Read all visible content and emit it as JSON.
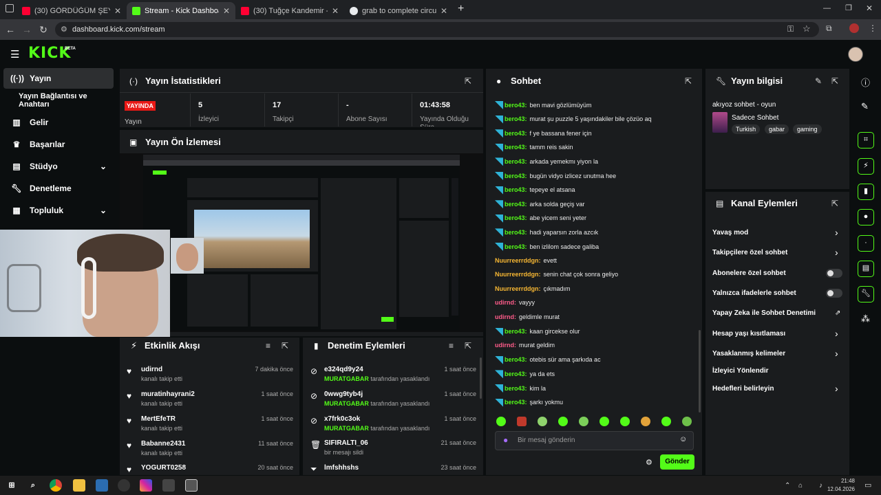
{
  "browser": {
    "tabs": [
      {
        "title": "(30) GÖRDÜĞÜM ŞEYLER GERÇ",
        "active": false
      },
      {
        "title": "Stream - Kick Dashboard",
        "active": true
      },
      {
        "title": "(30) Tuğçe Kandemir - Yanlış -",
        "active": false
      },
      {
        "title": "grab to complete circuit çeviri",
        "active": false
      }
    ],
    "new_tab": "+",
    "url": "dashboard.kick.com/stream"
  },
  "app": {
    "logo": "KICK",
    "beta": "BETA"
  },
  "sidebar": {
    "items": [
      {
        "label": "Yayın",
        "icon": "broadcast-icon"
      },
      {
        "label": "Yayın Bağlantısı ve Anahtarı",
        "icon": ""
      },
      {
        "label": "Gelir",
        "icon": "chart-icon"
      },
      {
        "label": "Başarılar",
        "icon": "trophy-icon"
      },
      {
        "label": "Stüdyo",
        "icon": "studio-icon"
      },
      {
        "label": "Denetleme",
        "icon": "wrench-icon"
      },
      {
        "label": "Topluluk",
        "icon": "community-icon"
      }
    ]
  },
  "stats": {
    "title": "Yayın İstatistikleri",
    "live_badge": "YAYINDA",
    "live_label": "Yayın",
    "items": [
      {
        "value": "5",
        "label": "İzleyici"
      },
      {
        "value": "17",
        "label": "Takipçi"
      },
      {
        "value": "-",
        "label": "Abone Sayısı"
      },
      {
        "value": "01:43:58",
        "label": "Yayında Olduğu Süre"
      }
    ]
  },
  "preview": {
    "title": "Yayın Ön İzlemesi"
  },
  "activity": {
    "title": "Etkinlik Akışı",
    "rows": [
      {
        "name": "udirnd",
        "sub": "kanalı takip etti",
        "time": "7 dakika önce"
      },
      {
        "name": "muratinhayrani2",
        "sub": "kanalı takip etti",
        "time": "1 saat önce"
      },
      {
        "name": "MertEfeTR",
        "sub": "kanalı takip etti",
        "time": "1 saat önce"
      },
      {
        "name": "Babanne2431",
        "sub": "kanalı takip etti",
        "time": "11 saat önce"
      },
      {
        "name": "YOGURT0258",
        "sub": "",
        "time": "20 saat önce"
      }
    ]
  },
  "moderation": {
    "title": "Denetim Eylemleri",
    "rows": [
      {
        "name": "e324qd9y24",
        "mod": "MURATGABAR",
        "sub": "tarafından yasaklandı",
        "time": "1 saat önce",
        "icon": "ban-icon"
      },
      {
        "name": "0wwg9tyb4j",
        "mod": "MURATGABAR",
        "sub": "tarafından yasaklandı",
        "time": "1 saat önce",
        "icon": "ban-icon"
      },
      {
        "name": "x7frk0c3ok",
        "mod": "MURATGABAR",
        "sub": "tarafından yasaklandı",
        "time": "1 saat önce",
        "icon": "ban-icon"
      },
      {
        "name": "SIFIRALTI_06",
        "mod": "",
        "sub": "bir mesajı sildi",
        "time": "21 saat önce",
        "icon": "trash-icon"
      },
      {
        "name": "lmfshhshs",
        "mod": "",
        "sub": "",
        "time": "23 saat önce",
        "icon": "filter-icon"
      }
    ]
  },
  "chat": {
    "title": "Sohbet",
    "messages": [
      {
        "user": "bero43",
        "text": "ben mavi gözlümüyüm",
        "color": "#53fc18",
        "badge": true
      },
      {
        "user": "bero43",
        "text": "murat şu puzzle 5 yaşındakiler bile çözüo aq",
        "color": "#53fc18",
        "badge": true
      },
      {
        "user": "bero43",
        "text": "f ye bassana fener için",
        "color": "#53fc18",
        "badge": true
      },
      {
        "user": "bero43",
        "text": "tamm reis sakin",
        "color": "#53fc18",
        "badge": true
      },
      {
        "user": "bero43",
        "text": "arkada yemekmı yiyon la",
        "color": "#53fc18",
        "badge": true
      },
      {
        "user": "bero43",
        "text": "bugün vidyo izlicez unutma hee",
        "color": "#53fc18",
        "badge": true
      },
      {
        "user": "bero43",
        "text": "tepeye el atsana",
        "color": "#53fc18",
        "badge": true
      },
      {
        "user": "bero43",
        "text": "arka solda geçiş var",
        "color": "#53fc18",
        "badge": true
      },
      {
        "user": "bero43",
        "text": "abe yicem seni yeter",
        "color": "#53fc18",
        "badge": true
      },
      {
        "user": "bero43",
        "text": "hadi yaparsın zorla azcık",
        "color": "#53fc18",
        "badge": true
      },
      {
        "user": "bero43",
        "text": "ben izlilom sadece galiba",
        "color": "#53fc18",
        "badge": true
      },
      {
        "user": "Nuurreerrddgn",
        "text": "evett",
        "color": "#f7b733",
        "badge": false
      },
      {
        "user": "Nuurreerrddgn",
        "text": "senin chat çok sonra geliyo",
        "color": "#f7b733",
        "badge": false
      },
      {
        "user": "Nuurreerrddgn",
        "text": "çıkmadım",
        "color": "#f7b733",
        "badge": false
      },
      {
        "user": "udirnd",
        "text": "vayyy",
        "color": "#ff5c8a",
        "badge": false
      },
      {
        "user": "udirnd",
        "text": "geldimle murat",
        "color": "#ff5c8a",
        "badge": false
      },
      {
        "user": "bero43",
        "text": "kaan gircekse olur",
        "color": "#53fc18",
        "badge": true
      },
      {
        "user": "udirnd",
        "text": "murat geldim",
        "color": "#ff5c8a",
        "badge": false
      },
      {
        "user": "bero43",
        "text": "otebis sür ama şarkıda ac",
        "color": "#53fc18",
        "badge": true
      },
      {
        "user": "bero43",
        "text": "ya da ets",
        "color": "#53fc18",
        "badge": true
      },
      {
        "user": "bero43",
        "text": "kim la",
        "color": "#53fc18",
        "badge": true
      },
      {
        "user": "bero43",
        "text": "şarkı yokmu",
        "color": "#53fc18",
        "badge": true
      }
    ],
    "input_placeholder": "Bir mesaj gönderin",
    "send_label": "Gönder"
  },
  "stream_info": {
    "title": "Yayın bilgisi",
    "stream_title": "akıyoz sohbet - oyun",
    "category": "Sadece Sohbet",
    "tags": [
      "Turkish",
      "gabar",
      "gaming"
    ]
  },
  "channel_actions": {
    "title": "Kanal Eylemleri",
    "items": [
      {
        "label": "Yavaş mod",
        "control": "chevron"
      },
      {
        "label": "Takipçilere özel sohbet",
        "control": "chevron"
      },
      {
        "label": "Abonelere özel sohbet",
        "control": "toggle"
      },
      {
        "label": "Yalnızca ifadelerle sohbet",
        "control": "toggle"
      },
      {
        "label": "Yapay Zeka ile Sohbet Denetimi",
        "control": "external"
      },
      {
        "label": "Hesap yaşı kısıtlaması",
        "control": "chevron"
      },
      {
        "label": "Yasaklanmış kelimeler",
        "control": "chevron"
      },
      {
        "label": "İzleyici Yönlendir",
        "control": "none"
      },
      {
        "label": "Hedefleri belirleyin",
        "control": "chevron"
      }
    ]
  },
  "taskbar": {
    "time": "21:48",
    "date": "12.04.2026"
  },
  "colors": {
    "accent": "#53fc18",
    "live": "#e91916",
    "panel": "#1a1c1e",
    "background": "#0b0e0f"
  }
}
